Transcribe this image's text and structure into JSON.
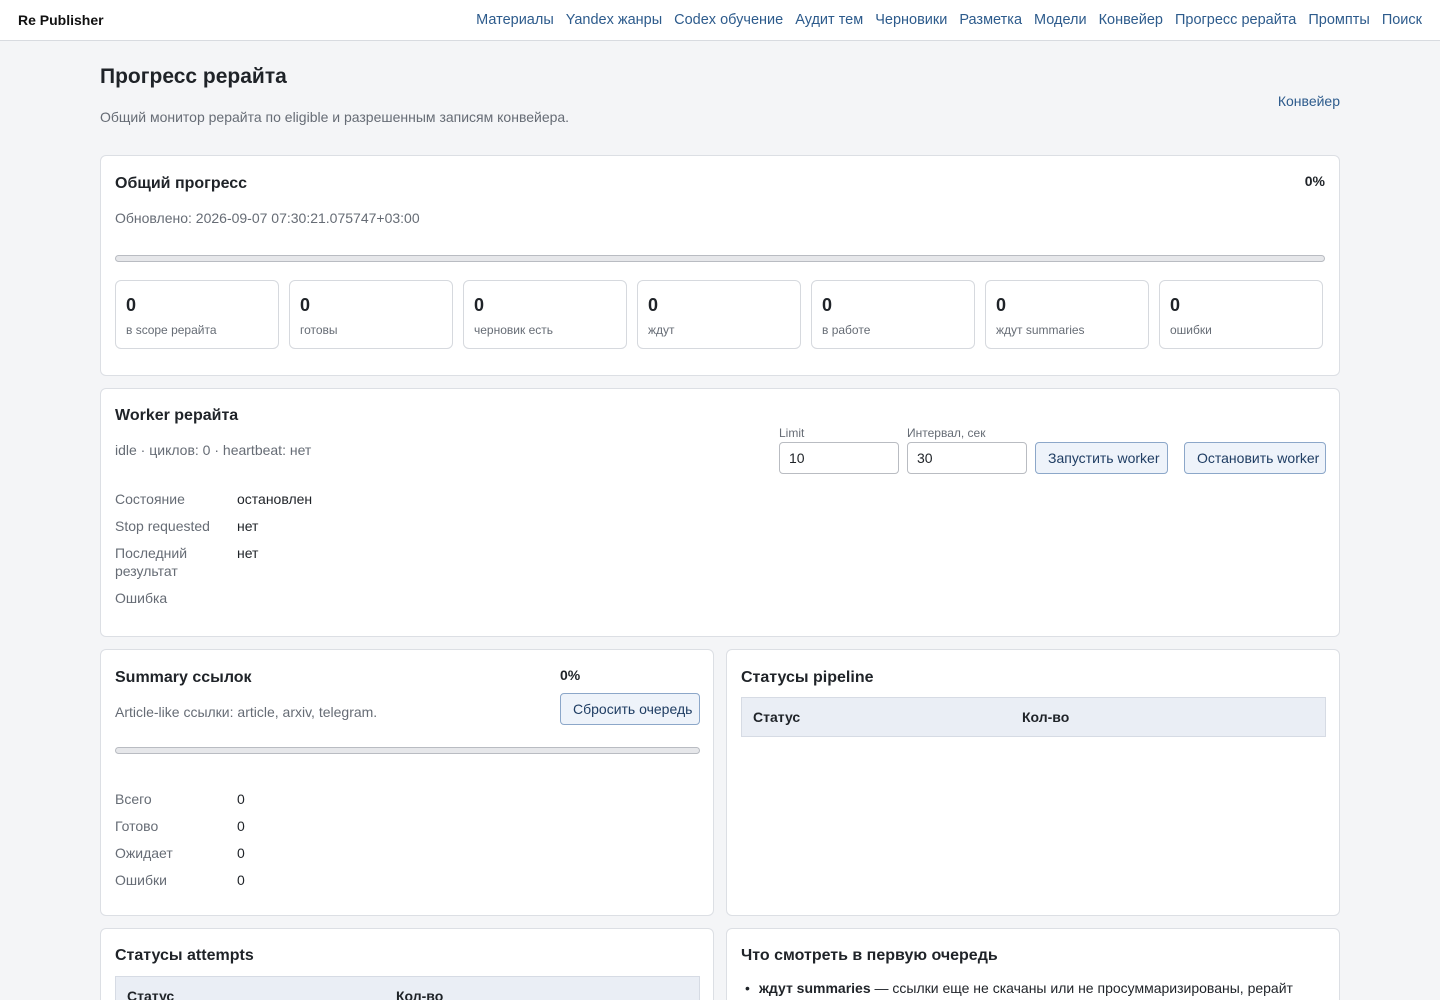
{
  "app": {
    "brand": "Re Publisher"
  },
  "nav": [
    "Материалы",
    "Yandex жанры",
    "Codex обучение",
    "Аудит тем",
    "Черновики",
    "Разметка",
    "Модели",
    "Конвейер",
    "Прогресс рерайта",
    "Промпты",
    "Поиск"
  ],
  "page": {
    "title": "Прогресс рерайта",
    "subtitle": "Общий монитор рерайта по eligible и разрешенным записям конвейера.",
    "link": "Конвейер"
  },
  "overall": {
    "title": "Общий прогресс",
    "percent": "0%",
    "progress_value": 0,
    "updated": "Обновлено: 2026-09-07 07:30:21.075747+03:00",
    "stats": [
      {
        "value": "0",
        "label": "в scope рерайта"
      },
      {
        "value": "0",
        "label": "готовы"
      },
      {
        "value": "0",
        "label": "черновик есть"
      },
      {
        "value": "0",
        "label": "ждут"
      },
      {
        "value": "0",
        "label": "в работе"
      },
      {
        "value": "0",
        "label": "ждут summaries"
      },
      {
        "value": "0",
        "label": "ошибки"
      }
    ]
  },
  "worker": {
    "title": "Worker рерайта",
    "status_line": "idle · циклов: 0 · heartbeat: нет",
    "limit_label": "Limit",
    "limit_value": "10",
    "interval_label": "Интервал, сек",
    "interval_value": "30",
    "start_label": "Запустить worker",
    "stop_label": "Остановить worker",
    "rows": [
      {
        "k": "Состояние",
        "v": "остановлен"
      },
      {
        "k": "Stop requested",
        "v": "нет"
      },
      {
        "k": "Последний результат",
        "v": "нет"
      },
      {
        "k": "Ошибка",
        "v": ""
      }
    ]
  },
  "summary": {
    "title": "Summary ссылок",
    "percent": "0%",
    "progress_value": 0,
    "description": "Article-like ссылки: article, arxiv, telegram.",
    "reset_label": "Сбросить очередь",
    "rows": [
      {
        "k": "Всего",
        "v": "0"
      },
      {
        "k": "Готово",
        "v": "0"
      },
      {
        "k": "Ожидает",
        "v": "0"
      },
      {
        "k": "Ошибки",
        "v": "0"
      }
    ]
  },
  "pipeline": {
    "title": "Статусы pipeline",
    "col_status": "Статус",
    "col_count": "Кол-во"
  },
  "attempts": {
    "title": "Статусы attempts",
    "col_status": "Статус",
    "col_count": "Кол-во"
  },
  "tips": {
    "title": "Что смотреть в первую очередь",
    "items": [
      {
        "bold": "ждут summaries",
        "text": " — ссылки еще не скачаны или не просуммаризированы, рерайт"
      }
    ]
  }
}
